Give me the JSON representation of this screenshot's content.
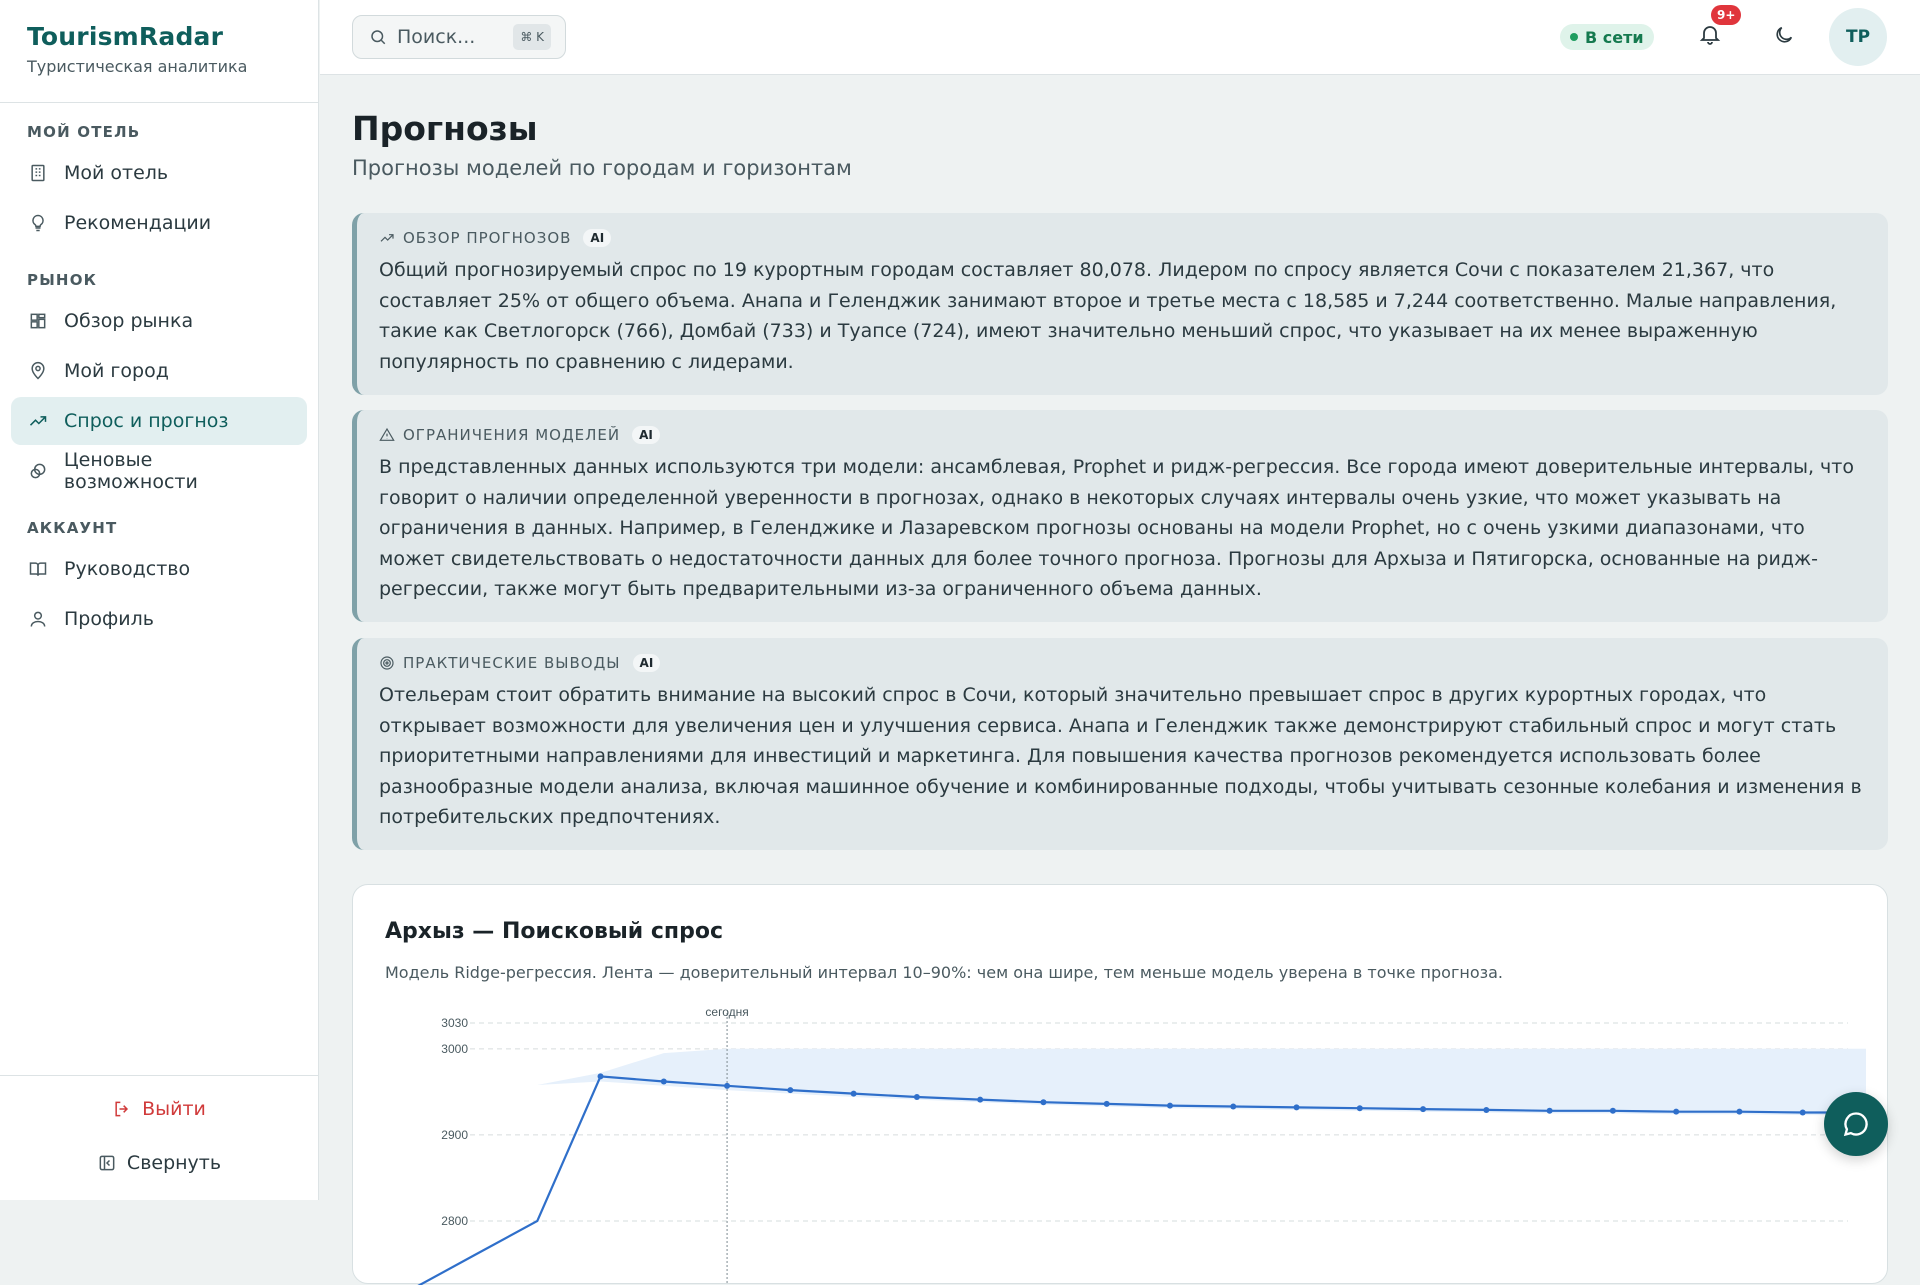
{
  "brand": {
    "title": "TourismRadar",
    "subtitle": "Туристическая аналитика"
  },
  "sidebar": {
    "sections": [
      {
        "label": "МОЙ ОТЕЛЬ",
        "items": [
          {
            "label": "Мой отель",
            "icon": "building-icon"
          },
          {
            "label": "Рекомендации",
            "icon": "lightbulb-icon"
          }
        ]
      },
      {
        "label": "РЫНОК",
        "items": [
          {
            "label": "Обзор рынка",
            "icon": "dashboard-icon"
          },
          {
            "label": "Мой город",
            "icon": "map-pin-icon"
          },
          {
            "label": "Спрос и прогноз",
            "icon": "trending-up-icon",
            "active": true
          },
          {
            "label": "Ценовые возможности",
            "icon": "coins-icon"
          }
        ]
      },
      {
        "label": "АККАУНТ",
        "items": [
          {
            "label": "Руководство",
            "icon": "book-icon"
          },
          {
            "label": "Профиль",
            "icon": "user-icon"
          }
        ]
      }
    ],
    "logout_label": "Выйти",
    "collapse_label": "Свернуть"
  },
  "header": {
    "search_placeholder": "Поиск...",
    "search_shortcut": "⌘ K",
    "status": "В сети",
    "notifications_badge": "9+",
    "avatar_initials": "ТР"
  },
  "page": {
    "title": "Прогнозы",
    "subtitle": "Прогнозы моделей по городам и горизонтам"
  },
  "insights": [
    {
      "heading": "ОБЗОР ПРОГНОЗОВ",
      "badge": "AI",
      "icon": "trending-up-icon",
      "body": "Общий прогнозируемый спрос по 19 курортным городам составляет 80,078. Лидером по спросу является Сочи с показателем 21,367, что составляет 25% от общего объема. Анапа и Геленджик занимают второе и третье места с 18,585 и 7,244 соответственно. Малые направления, такие как Светлогорск (766), Домбай (733) и Туапсе (724), имеют значительно меньший спрос, что указывает на их менее выраженную популярность по сравнению с лидерами."
    },
    {
      "heading": "ОГРАНИЧЕНИЯ МОДЕЛЕЙ",
      "badge": "AI",
      "icon": "warning-icon",
      "body": "В представленных данных используются три модели: ансамблевая, Prophet и ридж-регрессия. Все города имеют доверительные интервалы, что говорит о наличии определенной уверенности в прогнозах, однако в некоторых случаях интервалы очень узкие, что может указывать на ограничения в данных. Например, в Геленджике и Лазаревском прогнозы основаны на модели Prophet, но с очень узкими диапазонами, что может свидетельствовать о недостаточности данных для более точного прогноза. Прогнозы для Архыза и Пятигорска, основанные на ридж-регрессии, также могут быть предварительными из-за ограниченного объема данных."
    },
    {
      "heading": "ПРАКТИЧЕСКИЕ ВЫВОДЫ",
      "badge": "AI",
      "icon": "target-icon",
      "body": "Отельерам стоит обратить внимание на высокий спрос в Сочи, который значительно превышает спрос в других курортных городах, что открывает возможности для увеличения цен и улучшения сервиса. Анапа и Геленджик также демонстрируют стабильный спрос и могут стать приоритетными направлениями для инвестиций и маркетинга. Для повышения качества прогнозов рекомендуется использовать более разнообразные модели анализа, включая машинное обучение и комбинированные подходы, чтобы учитывать сезонные колебания и изменения в потребительских предпочтениях."
    }
  ],
  "chart_card": {
    "title": "Архыз — Поисковый спрос",
    "subtitle": "Модель Ridge-регрессия. Лента — доверительный интервал 10–90%: чем она шире, тем меньше модель уверена в точке прогноза.",
    "today_label": "сегодня"
  },
  "chart_data": {
    "type": "line",
    "title": "Архыз — Поисковый спрос",
    "xlabel": "",
    "ylabel": "",
    "yticks": [
      2800,
      2900,
      3000,
      3030
    ],
    "ylim": [
      2785,
      3030
    ],
    "today_index": 5,
    "series": [
      {
        "values": [
          2720,
          2760,
          2800,
          2968,
          2962,
          2957,
          2952,
          2948,
          2944,
          2941,
          2938,
          2936,
          2934,
          2933,
          2932,
          2931,
          2930,
          2929,
          2928,
          2928,
          2927,
          2927,
          2926,
          2926
        ]
      }
    ],
    "band_lower": [
      2935,
      2915,
      2958,
      2962,
      2957,
      2952,
      2948,
      2944,
      2941,
      2938,
      2935,
      2933,
      2931,
      2930,
      2929,
      2928,
      2927,
      2926,
      2925,
      2925,
      2924,
      2924,
      2923,
      2923
    ],
    "band_upper": [
      2935,
      2915,
      2958,
      2972,
      2995,
      3000,
      3000,
      3000,
      3000,
      3000,
      3000,
      3000,
      3000,
      3000,
      3000,
      3000,
      3000,
      3000,
      3000,
      3000,
      3000,
      3000,
      3000,
      3000
    ],
    "colors": {
      "line": "#2f6fca",
      "band": "#e6f0fb"
    },
    "grid": true
  },
  "colors": {
    "accent": "#0f5e5c",
    "danger": "#d03a3a",
    "online": "#1f9d60"
  }
}
